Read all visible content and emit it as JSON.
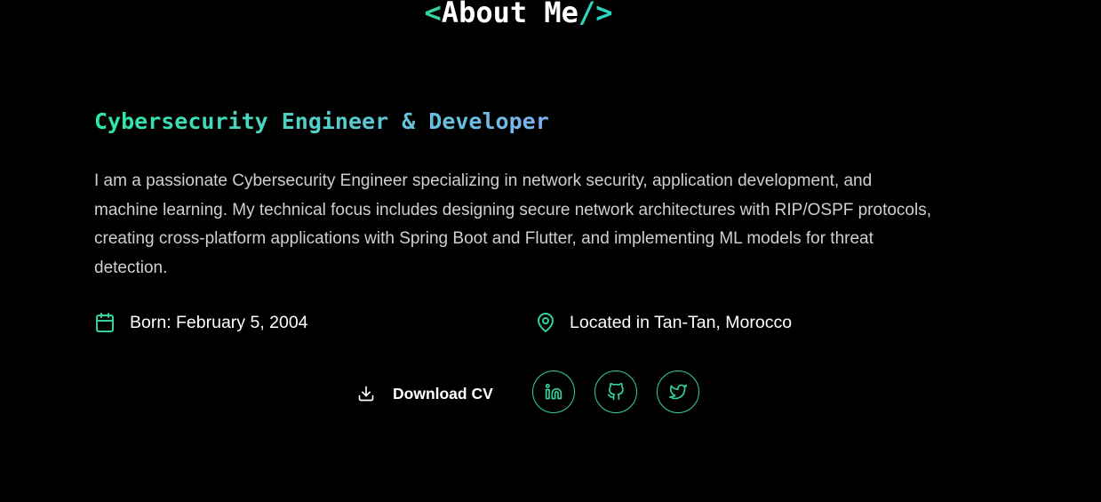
{
  "heading": {
    "open_tag": "<",
    "text": "About Me",
    "close_tag": "/>"
  },
  "role_title": "Cybersecurity Engineer & Developer",
  "bio": "I am a passionate Cybersecurity Engineer specializing in network security, application development, and machine learning. My technical focus includes designing secure network architectures with RIP/OSPF protocols, creating cross-platform applications with Spring Boot and Flutter, and implementing ML models for threat detection.",
  "info": {
    "born": "Born: February 5, 2004",
    "location": "Located in Tan-Tan, Morocco"
  },
  "actions": {
    "download_cv": "Download CV"
  },
  "icons": {
    "calendar": "calendar-icon",
    "location": "map-pin-icon",
    "download": "download-icon",
    "linkedin": "linkedin-icon",
    "github": "github-icon",
    "twitter": "twitter-icon"
  },
  "colors": {
    "background": "#000000",
    "accent": "#34d399",
    "text": "#ffffff",
    "muted_text": "#cfcfd4",
    "gradient_end": "#7cb3f0"
  }
}
